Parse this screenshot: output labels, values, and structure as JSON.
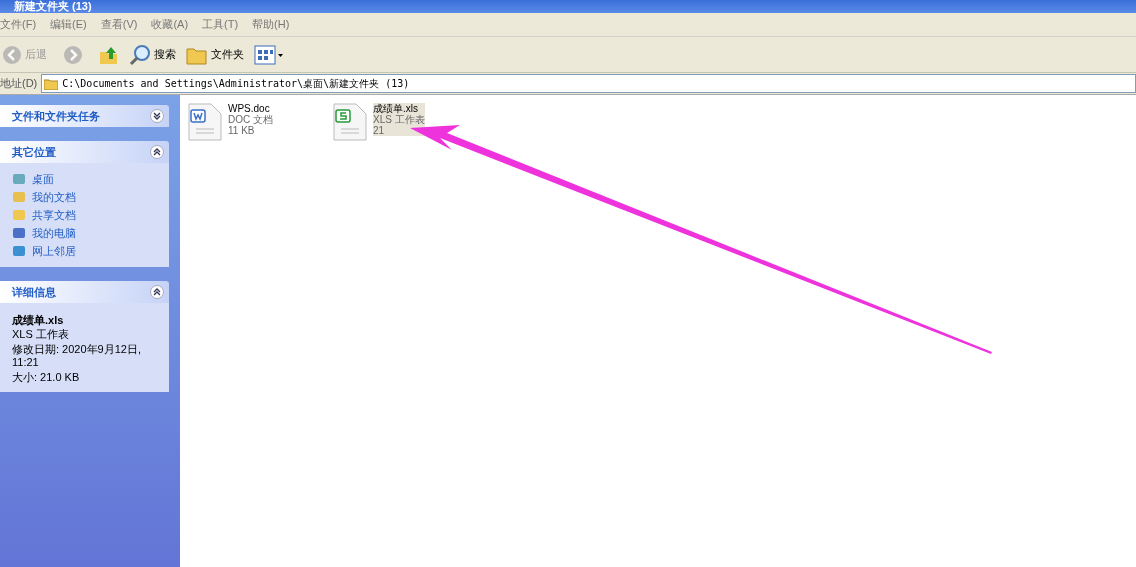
{
  "window": {
    "title": "新建文件夹 (13)"
  },
  "menu": [
    "文件(F)",
    "编辑(E)",
    "查看(V)",
    "收藏(A)",
    "工具(T)",
    "帮助(H)"
  ],
  "toolbar": [
    {
      "kind": "back",
      "label": "后退",
      "disabled": true
    },
    {
      "kind": "forward",
      "disabled": true
    },
    {
      "kind": "up"
    },
    {
      "kind": "search",
      "label": "搜索"
    },
    {
      "kind": "folders",
      "label": "文件夹"
    },
    {
      "kind": "views"
    }
  ],
  "address": {
    "label": "地址(D)",
    "value": "C:\\Documents and Settings\\Administrator\\桌面\\新建文件夹 (13)"
  },
  "sidebar": {
    "panels": [
      {
        "title": "文件和文件夹任务",
        "expanded": false
      },
      {
        "kind": "places",
        "title": "其它位置",
        "expanded": true,
        "items": [
          {
            "kind": "desktop",
            "label": "桌面"
          },
          {
            "kind": "documents",
            "label": "我的文档"
          },
          {
            "kind": "shared",
            "label": "共享文档"
          },
          {
            "kind": "computer",
            "label": "我的电脑"
          },
          {
            "kind": "network",
            "label": "网上邻居"
          }
        ]
      },
      {
        "kind": "details",
        "title": "详细信息",
        "expanded": true,
        "name": "成绩单.xls",
        "type": "XLS 工作表",
        "modified": "修改日期: 2020年9月12日, 11:21",
        "size": "大小: 21.0 KB"
      }
    ]
  },
  "files": [
    {
      "kind": "doc",
      "name": "WPS.doc",
      "type": "DOC 文档",
      "size": "11 KB",
      "selected": false
    },
    {
      "kind": "xls",
      "name": "成绩单.xls",
      "type": "XLS 工作表",
      "size": "21",
      "selected": true
    }
  ]
}
